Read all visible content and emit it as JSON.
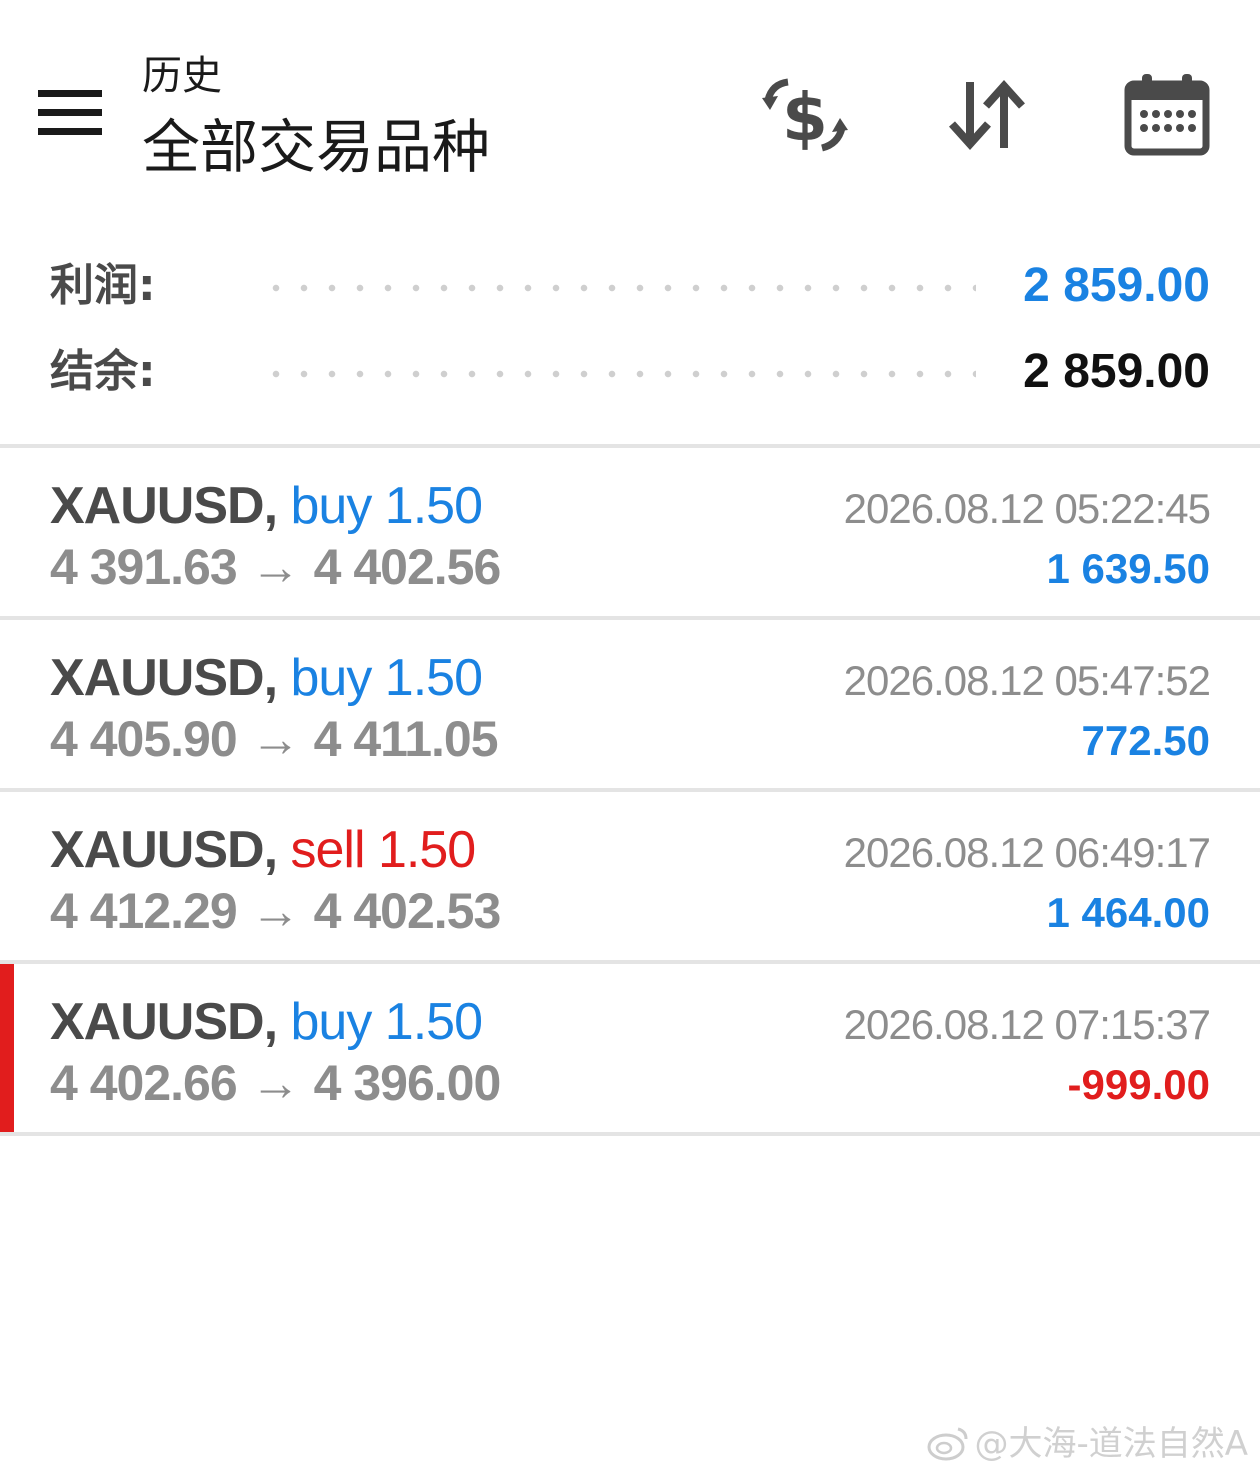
{
  "header": {
    "subtitle": "历史",
    "title": "全部交易品种",
    "icons": [
      "menu-icon",
      "currency-exchange-icon",
      "sort-icon",
      "calendar-icon"
    ]
  },
  "summary": {
    "profit_label": "利润:",
    "profit_value": "2 859.00",
    "balance_label": "结余:",
    "balance_value": "2 859.00"
  },
  "trades": [
    {
      "symbol": "XAUUSD,",
      "direction": "buy",
      "volume": "1.50",
      "open_price": "4 391.63",
      "arrow": "→",
      "close_price": "4 402.56",
      "time": "2026.08.12 05:22:45",
      "profit": "1 639.50"
    },
    {
      "symbol": "XAUUSD,",
      "direction": "buy",
      "volume": "1.50",
      "open_price": "4 405.90",
      "arrow": "→",
      "close_price": "4 411.05",
      "time": "2026.08.12 05:47:52",
      "profit": "772.50"
    },
    {
      "symbol": "XAUUSD,",
      "direction": "sell",
      "volume": "1.50",
      "open_price": "4 412.29",
      "arrow": "→",
      "close_price": "4 402.53",
      "time": "2026.08.12 06:49:17",
      "profit": "1 464.00"
    },
    {
      "symbol": "XAUUSD,",
      "direction": "buy",
      "volume": "1.50",
      "open_price": "4 402.66",
      "arrow": "→",
      "close_price": "4 396.00",
      "time": "2026.08.12 07:15:37",
      "profit": "-999.00"
    }
  ],
  "colors": {
    "accent_blue": "#1a82e2",
    "sell_red": "#e11d1d",
    "muted_gray": "#8d8d8d"
  },
  "watermark": {
    "text": "@大海-道法自然A"
  }
}
